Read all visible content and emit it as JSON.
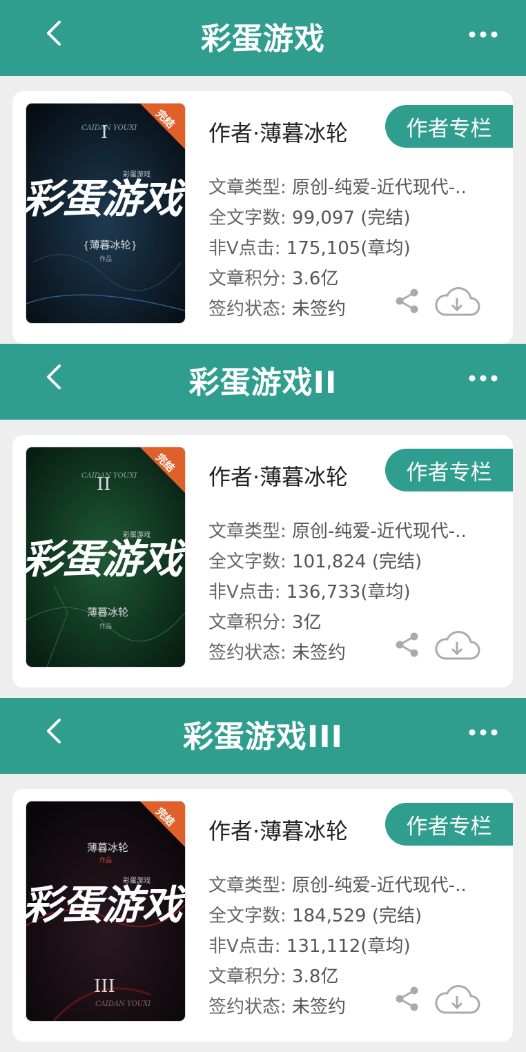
{
  "books": [
    {
      "header_title": "彩蛋游戏",
      "author": "作者·薄暮冰轮",
      "column_button": "作者专栏",
      "cover": {
        "numeral": "I",
        "title": "彩蛋游戏",
        "subtitle": "彩蛋游戏",
        "author": "{薄暮冰轮}",
        "work_tag": "作品",
        "badge": "完结",
        "latin": "CAIDAN YOUXI"
      },
      "rows": [
        {
          "label": "文章类型:",
          "value": "原创-纯爱-近代现代-.."
        },
        {
          "label": "全文字数:",
          "value": "99,097 (完结)"
        },
        {
          "label": "非V点击:",
          "value": "175,105(章均)"
        },
        {
          "label": "文章积分:",
          "value": "3.6亿"
        },
        {
          "label": "签约状态:",
          "value": "未签约"
        }
      ]
    },
    {
      "header_title": "彩蛋游戏II",
      "author": "作者·薄暮冰轮",
      "column_button": "作者专栏",
      "cover": {
        "numeral": "II",
        "title": "彩蛋游戏",
        "subtitle": "彩蛋游戏",
        "author": "薄暮冰轮",
        "work_tag": "作品",
        "badge": "完结",
        "latin": "CAIDAN YOUXI"
      },
      "rows": [
        {
          "label": "文章类型:",
          "value": "原创-纯爱-近代现代-.."
        },
        {
          "label": "全文字数:",
          "value": "101,824 (完结)"
        },
        {
          "label": "非V点击:",
          "value": "136,733(章均)"
        },
        {
          "label": "文章积分:",
          "value": "3亿"
        },
        {
          "label": "签约状态:",
          "value": "未签约"
        }
      ]
    },
    {
      "header_title": "彩蛋游戏III",
      "author": "作者·薄暮冰轮",
      "column_button": "作者专栏",
      "cover": {
        "numeral": "III",
        "title": "彩蛋游戏",
        "subtitle": "彩蛋游戏",
        "author": "薄暮冰轮",
        "work_tag": "作品",
        "badge": "完结",
        "latin": "CAIDAN YOUXI"
      },
      "rows": [
        {
          "label": "文章类型:",
          "value": "原创-纯爱-近代现代-.."
        },
        {
          "label": "全文字数:",
          "value": "184,529 (完结)"
        },
        {
          "label": "非V点击:",
          "value": "131,112(章均)"
        },
        {
          "label": "文章积分:",
          "value": "3.8亿"
        },
        {
          "label": "签约状态:",
          "value": "未签约"
        }
      ]
    }
  ],
  "icons": {
    "back": "chevron-left-icon",
    "more": "more-dots-icon",
    "share": "share-icon",
    "download": "cloud-download-icon"
  },
  "colors": {
    "accent": "#2f9e8e",
    "badge": "#e0602a",
    "cover1": "#0b1a24",
    "cover2": "#0d2a1c",
    "cover3": "#120e14"
  }
}
